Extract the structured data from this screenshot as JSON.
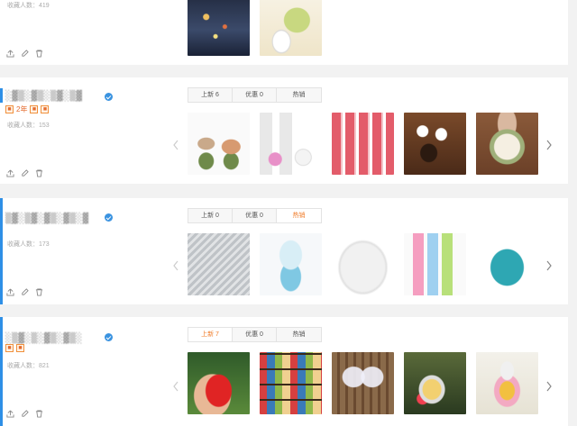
{
  "cards": [
    {
      "fav_label": "收藏人数：",
      "fav_count": "419"
    },
    {
      "shop_name": "░▓▒░▓▒░▒▓░▒▓",
      "badge_years": "2年",
      "fav_label": "收藏人数：",
      "fav_count": "153",
      "tabs": [
        "上新 6",
        "优惠 0",
        "热销"
      ],
      "active_tab": 0
    },
    {
      "shop_name": "▒▓░▒▓░▓▒░▓▒░▓",
      "fav_label": "收藏人数：",
      "fav_count": "173",
      "tabs": [
        "上新 0",
        "优惠 0",
        "热销"
      ],
      "active_tab": 2
    },
    {
      "shop_name": "░▒▓░▒░▓▒░▓▒░",
      "fav_label": "收藏人数：",
      "fav_count": "821",
      "tabs": [
        "上新 7",
        "优惠 0",
        "热销"
      ],
      "active_tab": 0
    }
  ],
  "colors": {
    "accent": "#2e8fe6",
    "active_tab": "#f07c2a",
    "badge": "#f0903c"
  },
  "icons": [
    "share-icon",
    "edit-icon",
    "trash-icon",
    "verified-icon",
    "chevron-left-icon",
    "chevron-right-icon"
  ]
}
